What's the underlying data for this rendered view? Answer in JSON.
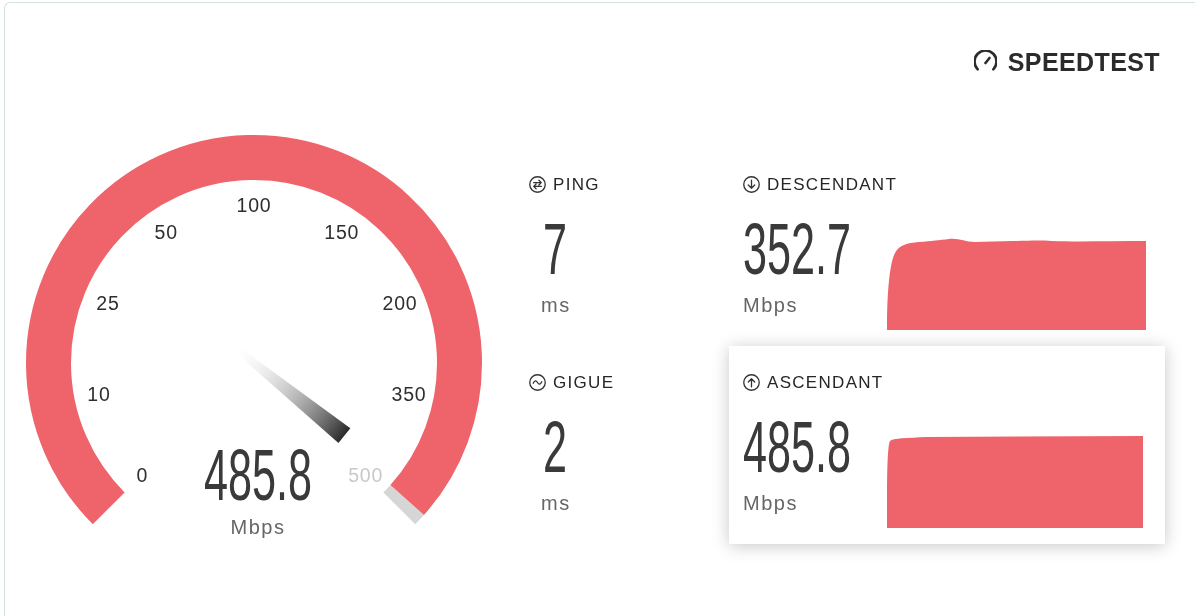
{
  "logo": {
    "text": "SPEEDTEST"
  },
  "gauge": {
    "ticks": [
      {
        "label": "0",
        "reached": true
      },
      {
        "label": "10",
        "reached": true
      },
      {
        "label": "25",
        "reached": true
      },
      {
        "label": "50",
        "reached": true
      },
      {
        "label": "100",
        "reached": true
      },
      {
        "label": "150",
        "reached": true
      },
      {
        "label": "200",
        "reached": true
      },
      {
        "label": "350",
        "reached": true
      },
      {
        "label": "500",
        "reached": false
      }
    ],
    "value": "485.8",
    "unit": "Mbps"
  },
  "latency": [
    {
      "kind": "ping",
      "label": "PING",
      "value": "7",
      "unit": "ms"
    },
    {
      "kind": "jitter",
      "label": "GIGUE",
      "value": "2",
      "unit": "ms"
    }
  ],
  "speeds": [
    {
      "kind": "download",
      "label": "DESCENDANT",
      "value": "352.7",
      "unit": "Mbps",
      "active": false
    },
    {
      "kind": "upload",
      "label": "ASCENDANT",
      "value": "485.8",
      "unit": "Mbps",
      "active": true
    }
  ]
}
